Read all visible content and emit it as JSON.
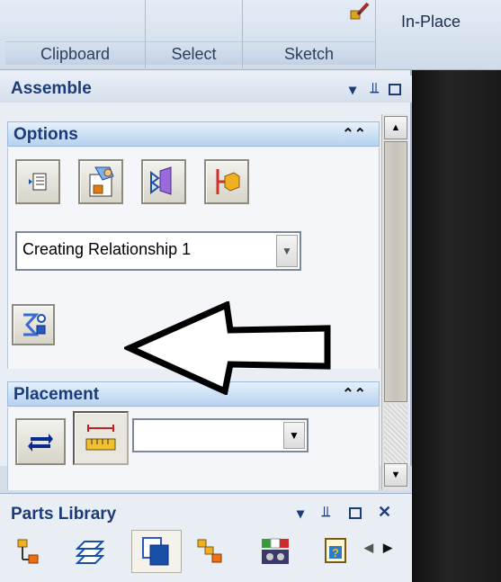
{
  "ribbon": {
    "groups": [
      {
        "label": "Clipboard"
      },
      {
        "label": "Select"
      },
      {
        "label": "Sketch"
      }
    ],
    "inplace_label": "In-Place"
  },
  "assemble": {
    "title": "Assemble",
    "options": {
      "title": "Options",
      "relationship_value": "Creating Relationship 1"
    },
    "placement": {
      "title": "Placement",
      "value": ""
    }
  },
  "parts_library": {
    "title": "Parts Library"
  },
  "icons": {
    "options_tools": [
      "list-icon",
      "part-select-icon",
      "align-faces-icon",
      "mate-icon"
    ],
    "relationship_tool": "relationship-types-icon",
    "placement_tools": [
      "flip-icon",
      "offset-ruler-icon"
    ],
    "parts_tools": [
      "tree-icon",
      "layers-icon",
      "copy-parts-icon",
      "hierarchy-icon",
      "gauge-icon",
      "document-icon"
    ]
  },
  "colors": {
    "section_header": "#b5d2ef",
    "panel_title_text": "#1c3c78",
    "viewport": "#1a1a1a"
  }
}
